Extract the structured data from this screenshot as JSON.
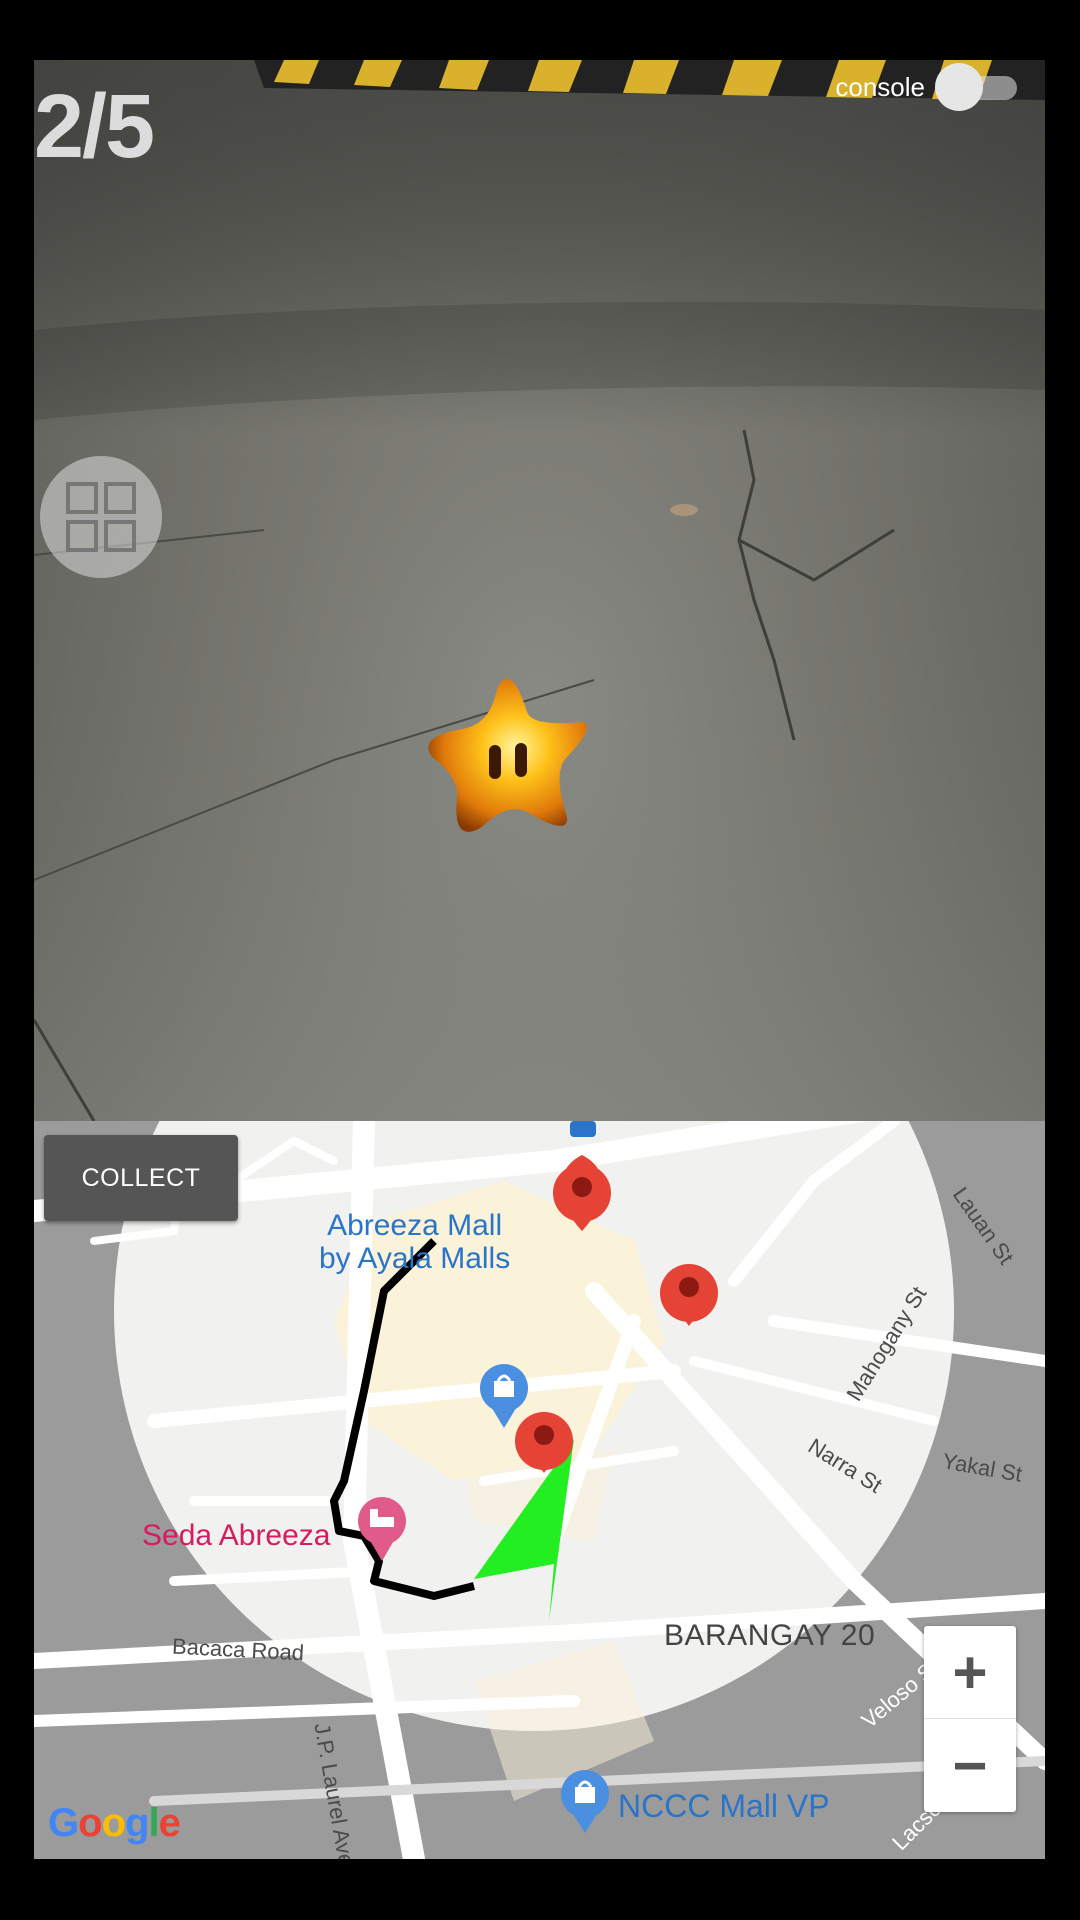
{
  "ar_view": {
    "progress_counter": "2/5",
    "console_toggle": {
      "label": "console",
      "enabled": false
    },
    "grid_menu_icon": "grid-icon",
    "collectible": "star-icon"
  },
  "map": {
    "collect_button_label": "COLLECT",
    "places": {
      "mall_name_line1": "Abreeza Mall",
      "mall_name_line2": "by Ayala Malls",
      "hotel": "Seda Abreeza",
      "district": "BARANGAY 20",
      "mall2": "NCCC Mall VP"
    },
    "streets": {
      "lauan": "Lauan St",
      "mahogany": "Mahogany St",
      "narra": "Narra St",
      "yakal": "Yakal St",
      "bacaca": "Bacaca Road",
      "jp_laurel": "J.P. Laurel Ave",
      "veloso": "Veloso St",
      "lacson": "Lacson St"
    },
    "zoom_in_label": "+",
    "zoom_out_label": "−",
    "attribution": "Google",
    "colors": {
      "marker": "#e44335",
      "player_arrow": "#22ee22",
      "path": "#000000",
      "place_blue": "#2a74c9",
      "hotel_pink": "#d81b60"
    }
  }
}
